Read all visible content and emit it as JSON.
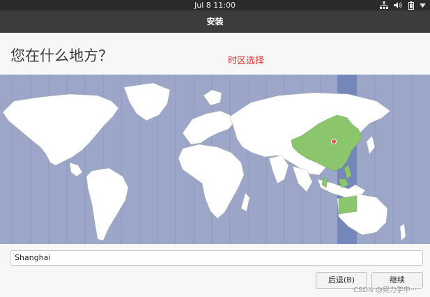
{
  "topbar": {
    "clock": "Jul 8  11:00",
    "icons": [
      "network-icon",
      "volume-icon",
      "battery-icon",
      "menu-chevron-icon"
    ]
  },
  "window": {
    "title": "安装"
  },
  "page": {
    "heading": "您在什么地方？",
    "annotation": "时区选择"
  },
  "map": {
    "colors": {
      "ocean": "#9ba6c8",
      "land": "#ffffff",
      "selected_region": "#8cc66c",
      "selected_band": "#7487b8",
      "marker": "#e05a4a"
    }
  },
  "timezone_input": {
    "value": "Shanghai"
  },
  "buttons": {
    "back": "后退(B)",
    "continue": "继续"
  },
  "watermark": "CSDN @努力学中···"
}
